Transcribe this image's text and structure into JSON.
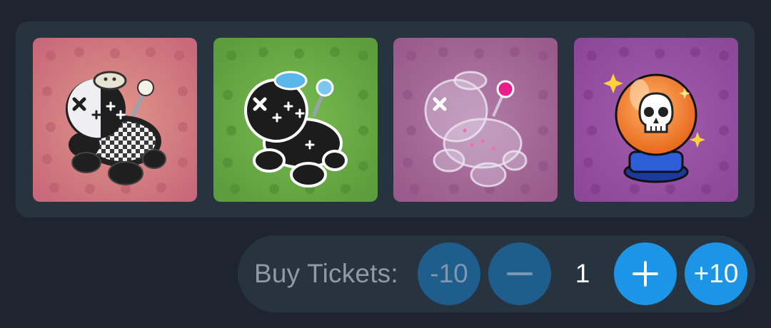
{
  "gallery": {
    "items": [
      {
        "name": "voodoo-doll-checkered-icon",
        "bg": "#c96b7a",
        "bg_inner": "#dd8c86"
      },
      {
        "name": "voodoo-doll-black-icon",
        "bg": "#5c9e3c",
        "bg_inner": "#6fb44b"
      },
      {
        "name": "voodoo-doll-ghost-icon",
        "bg": "#9c5e8e",
        "bg_inner": "#b07aa6"
      },
      {
        "name": "crystal-ball-skull-icon",
        "bg": "#8f4a9a",
        "bg_inner": "#a05aab"
      }
    ]
  },
  "buy": {
    "label": "Buy Tickets:",
    "minus10_label": "-10",
    "minus_icon": "minus-icon",
    "quantity": "1",
    "plus_icon": "plus-icon",
    "plus10_label": "+10"
  },
  "colors": {
    "page_bg": "#1e2530",
    "panel_bg": "#283340",
    "button_active": "#1c95e6",
    "button_disabled": "#1f5d8c"
  }
}
